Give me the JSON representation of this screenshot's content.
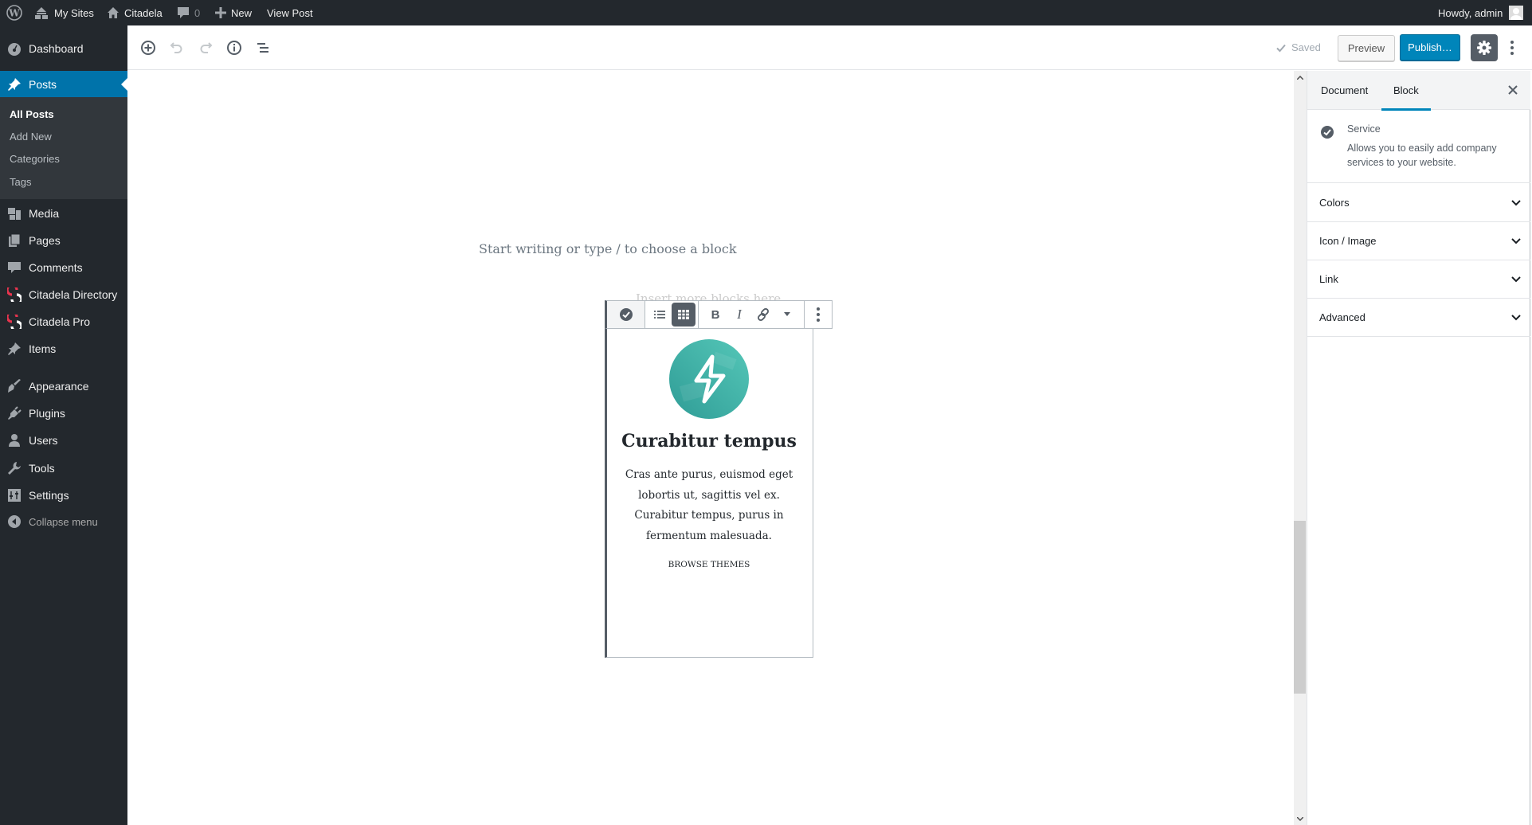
{
  "admin_bar": {
    "wp_logo": "wordpress-logo-icon",
    "my_sites": "My Sites",
    "site_name": "Citadela",
    "comments_count": "0",
    "new_label": "New",
    "view_post": "View Post",
    "greeting": "Howdy, admin"
  },
  "menu": {
    "items": [
      {
        "label": "Dashboard",
        "icon": "dashboard-icon"
      },
      {
        "label": "Posts",
        "icon": "pin-icon",
        "current": true
      },
      {
        "label": "Media",
        "icon": "media-icon"
      },
      {
        "label": "Pages",
        "icon": "pages-icon"
      },
      {
        "label": "Comments",
        "icon": "comment-icon"
      },
      {
        "label": "Citadela Directory",
        "icon": "citadela-icon"
      },
      {
        "label": "Citadela Pro",
        "icon": "citadela-icon"
      },
      {
        "label": "Items",
        "icon": "pin-icon"
      },
      {
        "label": "Appearance",
        "icon": "brush-icon"
      },
      {
        "label": "Plugins",
        "icon": "plugin-icon"
      },
      {
        "label": "Users",
        "icon": "user-icon"
      },
      {
        "label": "Tools",
        "icon": "wrench-icon"
      },
      {
        "label": "Settings",
        "icon": "settings-sliders-icon"
      }
    ],
    "submenu": [
      {
        "label": "All Posts",
        "current": true
      },
      {
        "label": "Add New"
      },
      {
        "label": "Categories"
      },
      {
        "label": "Tags"
      }
    ],
    "collapse": "Collapse menu"
  },
  "editor_header": {
    "saved": "Saved",
    "preview": "Preview",
    "publish": "Publish…"
  },
  "canvas": {
    "appender_placeholder": "Start writing or type / to choose a block",
    "inner_placeholder": "Insert more blocks here"
  },
  "service_block": {
    "title": "Curabitur tempus",
    "text": "Cras ante purus, euismod eget lobortis ut, sagittis vel ex. Curabitur tempus, purus in fermentum malesuada.",
    "link": "BROWSE THEMES",
    "icon": "lightning-icon",
    "icon_colors": [
      "#2f9c96",
      "#55c7b8"
    ]
  },
  "sidebar": {
    "tabs": [
      {
        "label": "Document",
        "active": false
      },
      {
        "label": "Block",
        "active": true
      }
    ],
    "block_card": {
      "title": "Service",
      "description": "Allows you to easily add company services to your website."
    },
    "panels": [
      "Colors",
      "Icon / Image",
      "Link",
      "Advanced"
    ]
  },
  "colors": {
    "admin_bg": "#23282d",
    "accent": "#0073aa",
    "publish": "#0085ba"
  }
}
